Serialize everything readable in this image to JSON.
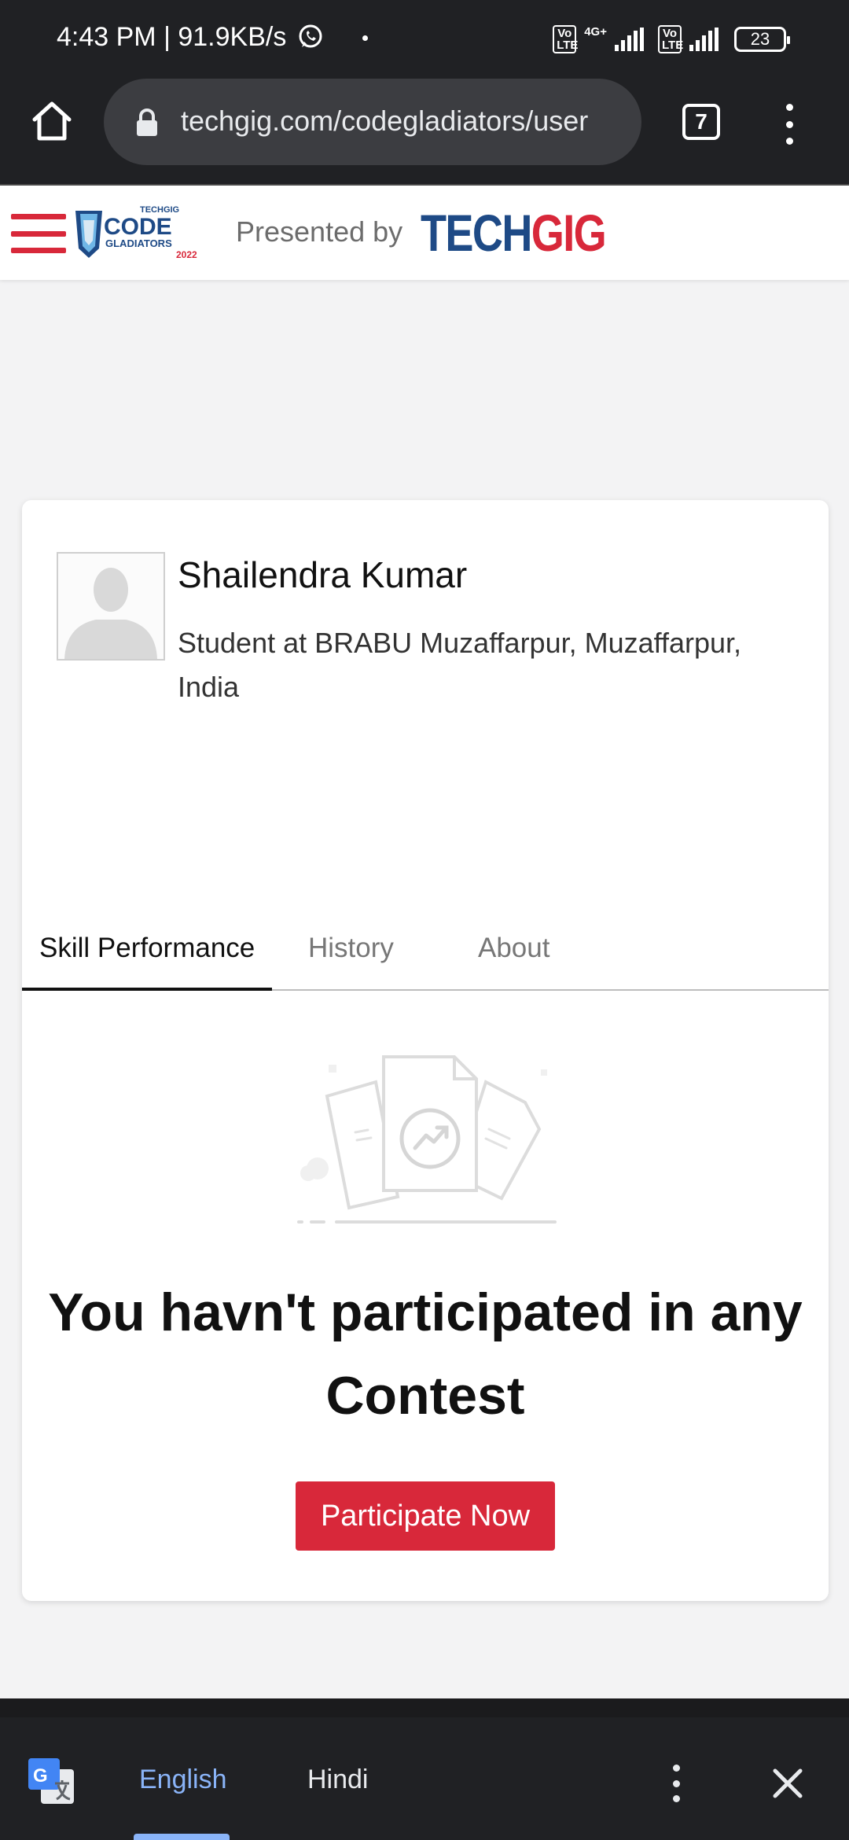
{
  "status_bar": {
    "time": "4:43 PM | 91.9KB/s",
    "net_type": "4G+",
    "lte_badge": "Vo LTE",
    "battery": "23"
  },
  "browser": {
    "url": "techgig.com/codegladiators/user",
    "tab_count": "7"
  },
  "site_header": {
    "presented_by": "Presented by",
    "logo_brand": "TECH",
    "logo_brand_accent": "GIG",
    "event_logo_text": "CODE",
    "event_logo_sub": "GLADIATORS",
    "event_logo_year": "2022",
    "event_logo_top": "TECHGIG"
  },
  "profile": {
    "name": "Shailendra Kumar",
    "description": "Student at BRABU Muzaffarpur, Muzaffarpur, India"
  },
  "tabs": [
    {
      "label": "Skill Performance",
      "active": true
    },
    {
      "label": "History",
      "active": false
    },
    {
      "label": "About",
      "active": false
    }
  ],
  "empty_state": {
    "message": "You havn't participated in any Contest",
    "button_label": "Participate Now"
  },
  "translate_bar": {
    "languages": [
      "English",
      "Hindi"
    ],
    "selected": "English"
  },
  "colors": {
    "accent_red": "#d8283a",
    "brand_blue": "#1e4a86",
    "translate_blue": "#8ab4f8",
    "dark_bar": "#202124"
  },
  "icons": [
    "whatsapp-icon",
    "home-icon",
    "lock-icon",
    "hamburger-menu-icon",
    "google-translate-icon",
    "more-vert-icon",
    "close-icon",
    "avatar-placeholder-icon",
    "empty-documents-illustration"
  ]
}
